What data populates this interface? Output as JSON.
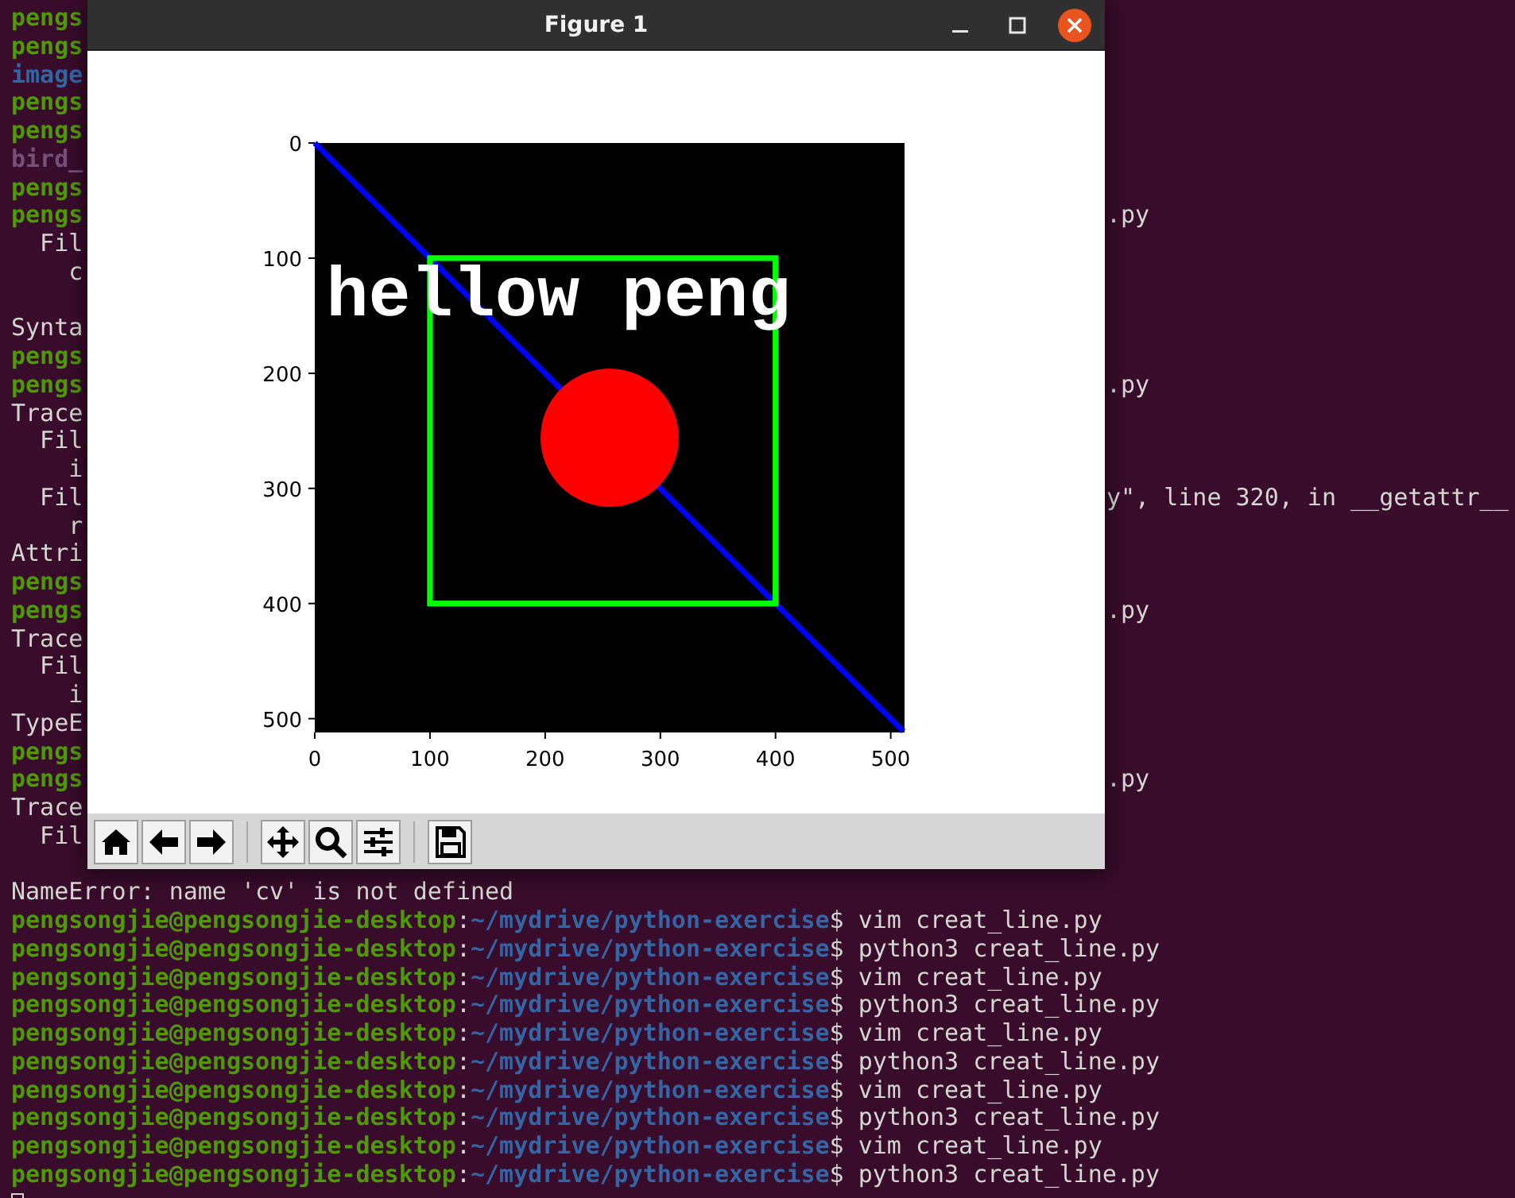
{
  "terminal": {
    "lines": [
      {
        "kind": "prompt",
        "user": "pengs"
      },
      {
        "kind": "prompt",
        "user": "pengs"
      },
      {
        "kind": "directory",
        "text": "image"
      },
      {
        "kind": "prompt",
        "user": "pengs"
      },
      {
        "kind": "prompt",
        "user": "pengs"
      },
      {
        "kind": "image-file",
        "text": "bird_"
      },
      {
        "kind": "prompt",
        "user": "pengs"
      },
      {
        "kind": "prompt",
        "user": "pengs",
        "tail": ".py"
      },
      {
        "kind": "output",
        "text": "  Fil"
      },
      {
        "kind": "output",
        "text": "    c"
      },
      {
        "kind": "blank"
      },
      {
        "kind": "output",
        "text": "Synta"
      },
      {
        "kind": "prompt",
        "user": "pengs"
      },
      {
        "kind": "prompt",
        "user": "pengs",
        "tail": ".py"
      },
      {
        "kind": "output",
        "text": "Trace"
      },
      {
        "kind": "output",
        "text": "  Fil"
      },
      {
        "kind": "output",
        "text": "    i"
      },
      {
        "kind": "output",
        "text": "  Fil",
        "tail": "y\", line 320, in __getattr__"
      },
      {
        "kind": "output",
        "text": "    r"
      },
      {
        "kind": "output",
        "text": "Attri"
      },
      {
        "kind": "prompt",
        "user": "pengs"
      },
      {
        "kind": "prompt",
        "user": "pengs",
        "tail": ".py"
      },
      {
        "kind": "output",
        "text": "Trace"
      },
      {
        "kind": "output",
        "text": "  Fil"
      },
      {
        "kind": "output",
        "text": "    i"
      },
      {
        "kind": "output",
        "text": "TypeE"
      },
      {
        "kind": "prompt",
        "user": "pengs"
      },
      {
        "kind": "prompt",
        "user": "pengs",
        "tail": ".py"
      },
      {
        "kind": "output",
        "text": "Trace"
      },
      {
        "kind": "output",
        "text": "  Fil"
      },
      {
        "kind": "blank"
      },
      {
        "kind": "output",
        "text": "NameError: name 'cv' is not defined"
      },
      {
        "kind": "prompt",
        "user": "pengsongjie@pengsongjie-desktop",
        "sep": ":",
        "path": "~/mydrive/python-exercise",
        "command": "$ vim creat_line.py"
      },
      {
        "kind": "prompt",
        "user": "pengsongjie@pengsongjie-desktop",
        "sep": ":",
        "path": "~/mydrive/python-exercise",
        "command": "$ python3 creat_line.py"
      },
      {
        "kind": "prompt",
        "user": "pengsongjie@pengsongjie-desktop",
        "sep": ":",
        "path": "~/mydrive/python-exercise",
        "command": "$ vim creat_line.py"
      },
      {
        "kind": "prompt",
        "user": "pengsongjie@pengsongjie-desktop",
        "sep": ":",
        "path": "~/mydrive/python-exercise",
        "command": "$ python3 creat_line.py"
      },
      {
        "kind": "prompt",
        "user": "pengsongjie@pengsongjie-desktop",
        "sep": ":",
        "path": "~/mydrive/python-exercise",
        "command": "$ vim creat_line.py"
      },
      {
        "kind": "prompt",
        "user": "pengsongjie@pengsongjie-desktop",
        "sep": ":",
        "path": "~/mydrive/python-exercise",
        "command": "$ python3 creat_line.py"
      },
      {
        "kind": "prompt",
        "user": "pengsongjie@pengsongjie-desktop",
        "sep": ":",
        "path": "~/mydrive/python-exercise",
        "command": "$ vim creat_line.py"
      },
      {
        "kind": "prompt",
        "user": "pengsongjie@pengsongjie-desktop",
        "sep": ":",
        "path": "~/mydrive/python-exercise",
        "command": "$ python3 creat_line.py"
      },
      {
        "kind": "prompt",
        "user": "pengsongjie@pengsongjie-desktop",
        "sep": ":",
        "path": "~/mydrive/python-exercise",
        "command": "$ vim creat_line.py"
      },
      {
        "kind": "prompt",
        "user": "pengsongjie@pengsongjie-desktop",
        "sep": ":",
        "path": "~/mydrive/python-exercise",
        "command": "$ python3 creat_line.py"
      }
    ],
    "cursor": true
  },
  "figure": {
    "title": "Figure 1",
    "plot": {
      "image_text": "hellow peng",
      "xticks": [
        "0",
        "100",
        "200",
        "300",
        "400",
        "500"
      ],
      "yticks": [
        "0",
        "100",
        "200",
        "300",
        "400",
        "500"
      ]
    }
  }
}
